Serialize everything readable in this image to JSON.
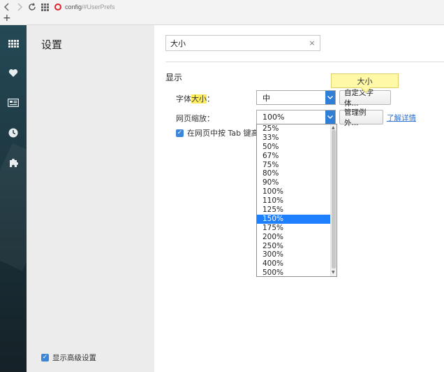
{
  "browser": {
    "address_scheme": "config",
    "address_path": "/#UserPrefs",
    "new_tab": "+"
  },
  "sidebar": {
    "icons": [
      "speed-dial-icon",
      "heart-icon",
      "news-icon",
      "history-icon",
      "extensions-icon"
    ]
  },
  "nav": {
    "title": "设置",
    "advanced_label": "显示高级设置",
    "advanced_checked": true
  },
  "search": {
    "value": "大小",
    "clear": "×"
  },
  "section": {
    "title": "显示"
  },
  "font_size": {
    "label_pre": "字体",
    "label_hl": "大小",
    "label_post": "：",
    "value": "中",
    "button": "自定义字体..."
  },
  "tooltip": "大小",
  "zoom": {
    "label": "网页缩放：",
    "value": "100%",
    "button": "管理例外...",
    "link": "了解详情",
    "options": [
      "25%",
      "33%",
      "50%",
      "67%",
      "75%",
      "80%",
      "90%",
      "100%",
      "110%",
      "125%",
      "150%",
      "175%",
      "200%",
      "250%",
      "300%",
      "400%",
      "500%"
    ],
    "highlighted": "150%"
  },
  "tab_highlight": {
    "label": "在网页中按 Tab 键高亮",
    "checked": true
  },
  "colors": {
    "accent": "#2f7fd6",
    "highlight": "#ffec5c",
    "selected_item": "#1e80ff"
  }
}
